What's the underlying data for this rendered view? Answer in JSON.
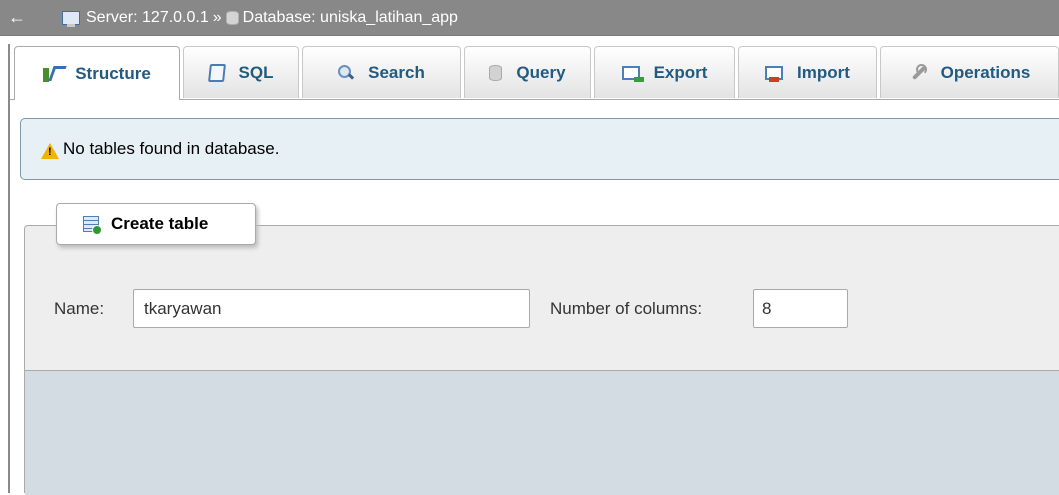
{
  "breadcrumb": {
    "back_icon": "left-arrow-icon",
    "server_label": "Server: 127.0.0.1",
    "separator": "»",
    "database_label": "Database: uniska_latihan_app"
  },
  "tabs": [
    {
      "label": "Structure",
      "icon": "structure-icon",
      "active": true
    },
    {
      "label": "SQL",
      "icon": "sql-icon",
      "active": false
    },
    {
      "label": "Search",
      "icon": "search-icon",
      "active": false
    },
    {
      "label": "Query",
      "icon": "query-icon",
      "active": false
    },
    {
      "label": "Export",
      "icon": "export-icon",
      "active": false
    },
    {
      "label": "Import",
      "icon": "import-icon",
      "active": false
    },
    {
      "label": "Operations",
      "icon": "wrench-icon",
      "active": false
    }
  ],
  "notice": {
    "icon": "warning-icon",
    "text": "No tables found in database."
  },
  "create_table": {
    "legend": "Create table",
    "name_label": "Name:",
    "name_value": "tkaryawan",
    "columns_label": "Number of columns:",
    "columns_value": "8"
  },
  "colors": {
    "topbar": "#888888",
    "tab_text": "#235a81",
    "notice_bg": "#e6f0f5",
    "fieldset_bg": "#eeeeee",
    "fieldset_footer": "#d3dce3"
  }
}
